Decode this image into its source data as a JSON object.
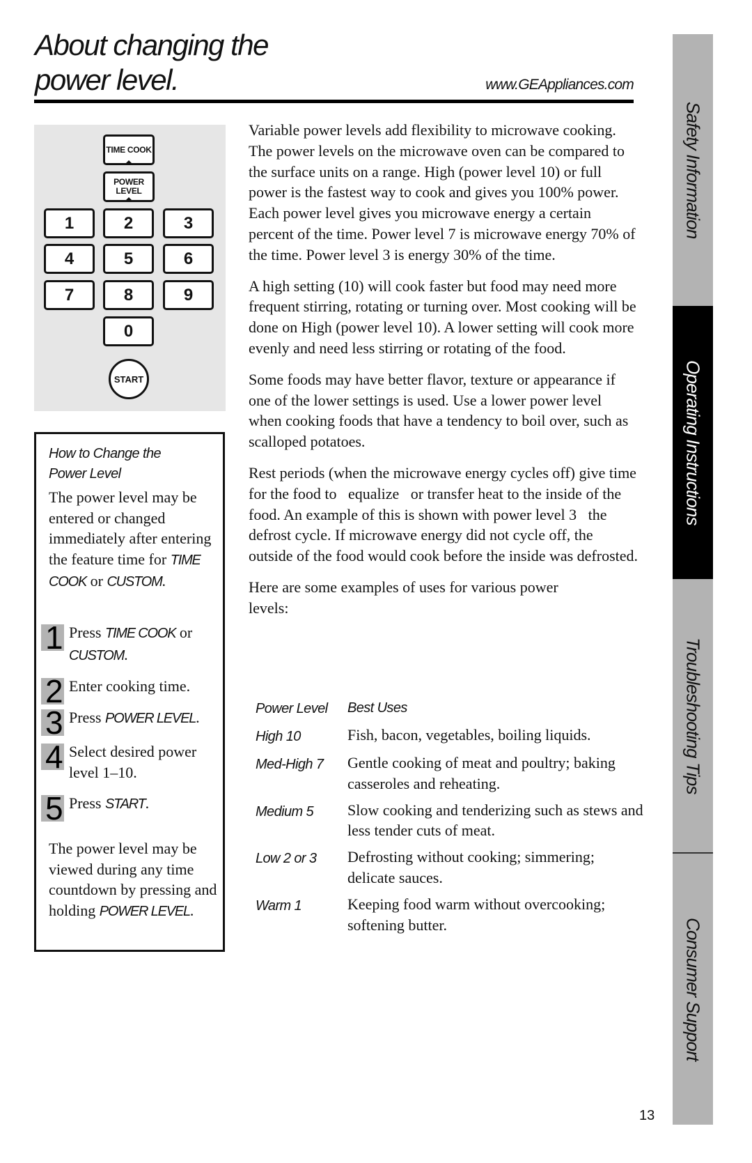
{
  "header": {
    "title_line1": "About changing the",
    "title_line2": "power level.",
    "site_url": "www.GEAppliances.com"
  },
  "keypad": {
    "time_cook": "TIME COOK",
    "power_level_line1": "POWER",
    "power_level_line2": "LEVEL",
    "digits": [
      "1",
      "2",
      "3",
      "4",
      "5",
      "6",
      "7",
      "8",
      "9",
      "0"
    ],
    "start": "START"
  },
  "instructions": {
    "heading_line1": "How to Change the",
    "heading_line2": "Power Level",
    "intro_text": "The power level may be entered or changed immediately after entering the feature time for ",
    "intro_it1": "TIME COOK",
    "intro_or": " or ",
    "intro_it2": "CUSTOM",
    "intro_end": ".",
    "steps": [
      {
        "num": "1",
        "text": "Press ",
        "it": "TIME COOK",
        "mid": " or ",
        "it2": "CUSTOM",
        "end": "."
      },
      {
        "num": "2",
        "text": "Enter cooking time."
      },
      {
        "num": "3",
        "text": "Press ",
        "it": "POWER LEVEL",
        "end": "."
      },
      {
        "num": "4",
        "text": "Select desired power level 1–10."
      },
      {
        "num": "5",
        "text": "Press ",
        "it": "START",
        "end": "."
      }
    ],
    "outro_text": "The power level may be viewed during any time countdown by pressing and holding ",
    "outro_it": "POWER LEVEL",
    "outro_end": "."
  },
  "main": {
    "paragraphs": [
      "Variable power levels add flexibility to microwave cooking. The power levels on the microwave oven can be compared to the surface units on a range. High (power level 10) or full power is the fastest way to cook and gives you 100% power. Each power level gives you microwave energy a certain percent of the time. Power level 7 is microwave energy 70% of the time. Power level 3 is energy 30% of the time.",
      "A high setting (10) will cook faster but food may need more frequent stirring, rotating or turning over. Most cooking will be done on High (power level 10). A lower setting will cook more evenly and need less stirring or rotating of the food.",
      "Some foods may have better flavor, texture or appearance if one of the lower settings is used. Use a lower power level when cooking foods that have a tendency to boil over, such as scalloped potatoes.",
      "Rest periods (when the microwave energy cycles off) give time for the food to   equalize   or transfer heat to the inside of the food. An example of this is shown with power level 3   the defrost cycle. If microwave energy did not cycle off, the outside of the food would cook before the inside was defrosted.",
      "Here are some examples of uses for various power levels:"
    ]
  },
  "uses_table": {
    "headers": [
      "Power Level",
      "Best Uses"
    ],
    "rows": [
      {
        "level": "High 10",
        "use": "Fish, bacon, vegetables, boiling liquids."
      },
      {
        "level": "Med-High 7",
        "use": "Gentle cooking of meat and poultry; baking casseroles and reheating."
      },
      {
        "level": "Medium 5",
        "use": "Slow cooking and tenderizing such as stews and less tender cuts of meat."
      },
      {
        "level": "Low 2 or 3",
        "use": "Defrosting without cooking; simmering; delicate sauces."
      },
      {
        "level": "Warm 1",
        "use": "Keeping food warm without overcooking; softening butter."
      }
    ]
  },
  "side_tabs": [
    {
      "label": "Safety Information",
      "active": false
    },
    {
      "label": "Operating Instructions",
      "active": true
    },
    {
      "label": "Troubleshooting Tips",
      "active": false
    },
    {
      "label": "Consumer Support",
      "active": false
    }
  ],
  "page_number": "13"
}
